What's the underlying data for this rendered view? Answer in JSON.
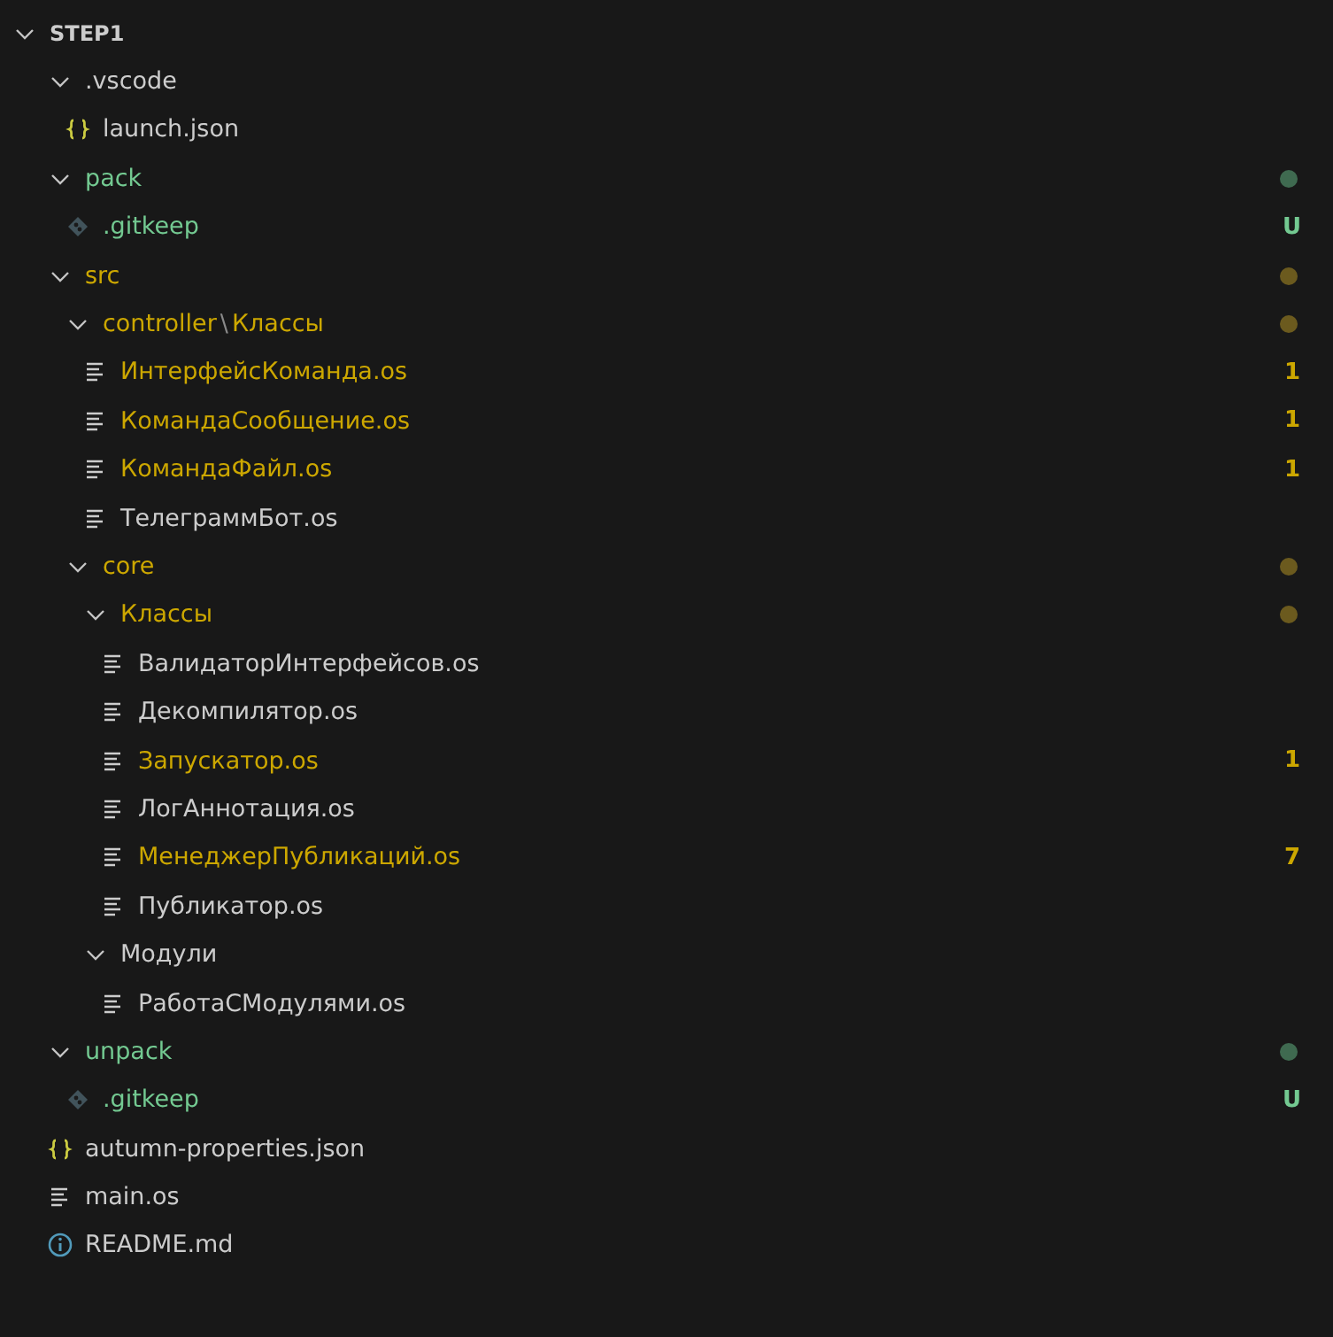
{
  "root": {
    "label": "STEP1",
    "expanded": true
  },
  "tree": [
    {
      "kind": "folder",
      "label": ".vscode",
      "expanded": true,
      "modified": false,
      "untracked": false,
      "children": [
        {
          "kind": "json-file",
          "label": "launch.json",
          "modified": false,
          "untracked": false
        }
      ]
    },
    {
      "kind": "folder",
      "label": "pack",
      "expanded": true,
      "modified": false,
      "untracked": true,
      "dot": true,
      "children": [
        {
          "kind": "git-file",
          "label": ".gitkeep",
          "modified": false,
          "untracked": true,
          "badge": "U"
        }
      ]
    },
    {
      "kind": "folder",
      "label": "src",
      "expanded": true,
      "modified": true,
      "untracked": false,
      "dot": true,
      "children": [
        {
          "kind": "folder",
          "path": [
            "controller",
            "Классы"
          ],
          "separator": "\\",
          "expanded": true,
          "modified": true,
          "untracked": false,
          "dot": true,
          "children": [
            {
              "kind": "text-file",
              "label": "ИнтерфейсКоманда.os",
              "modified": true,
              "untracked": false,
              "badge": "1"
            },
            {
              "kind": "text-file",
              "label": "КомандаСообщение.os",
              "modified": true,
              "untracked": false,
              "badge": "1"
            },
            {
              "kind": "text-file",
              "label": "КомандаФайл.os",
              "modified": true,
              "untracked": false,
              "badge": "1"
            },
            {
              "kind": "text-file",
              "label": "ТелеграммБот.os",
              "modified": false,
              "untracked": false
            }
          ]
        },
        {
          "kind": "folder",
          "label": "core",
          "expanded": true,
          "modified": true,
          "untracked": false,
          "dot": true,
          "children": [
            {
              "kind": "folder",
              "label": "Классы",
              "expanded": true,
              "modified": true,
              "untracked": false,
              "dot": true,
              "children": [
                {
                  "kind": "text-file",
                  "label": "ВалидаторИнтерфейсов.os",
                  "modified": false,
                  "untracked": false
                },
                {
                  "kind": "text-file",
                  "label": "Декомпилятор.os",
                  "modified": false,
                  "untracked": false
                },
                {
                  "kind": "text-file",
                  "label": "Запускатор.os",
                  "modified": true,
                  "untracked": false,
                  "badge": "1"
                },
                {
                  "kind": "text-file",
                  "label": "ЛогАннотация.os",
                  "modified": false,
                  "untracked": false
                },
                {
                  "kind": "text-file",
                  "label": "МенеджерПубликаций.os",
                  "modified": true,
                  "untracked": false,
                  "badge": "7"
                },
                {
                  "kind": "text-file",
                  "label": "Публикатор.os",
                  "modified": false,
                  "untracked": false
                }
              ]
            },
            {
              "kind": "folder",
              "label": "Модули",
              "expanded": true,
              "modified": false,
              "untracked": false,
              "children": [
                {
                  "kind": "text-file",
                  "label": "РаботаСМодулями.os",
                  "modified": false,
                  "untracked": false
                }
              ]
            }
          ]
        }
      ]
    },
    {
      "kind": "folder",
      "label": "unpack",
      "expanded": true,
      "modified": false,
      "untracked": true,
      "dot": true,
      "children": [
        {
          "kind": "git-file",
          "label": ".gitkeep",
          "modified": false,
          "untracked": true,
          "badge": "U"
        }
      ]
    },
    {
      "kind": "json-file",
      "label": "autumn-properties.json",
      "modified": false,
      "untracked": false
    },
    {
      "kind": "text-file",
      "label": "main.os",
      "modified": false,
      "untracked": false
    },
    {
      "kind": "info-file",
      "label": "README.md",
      "modified": false,
      "untracked": false
    }
  ]
}
